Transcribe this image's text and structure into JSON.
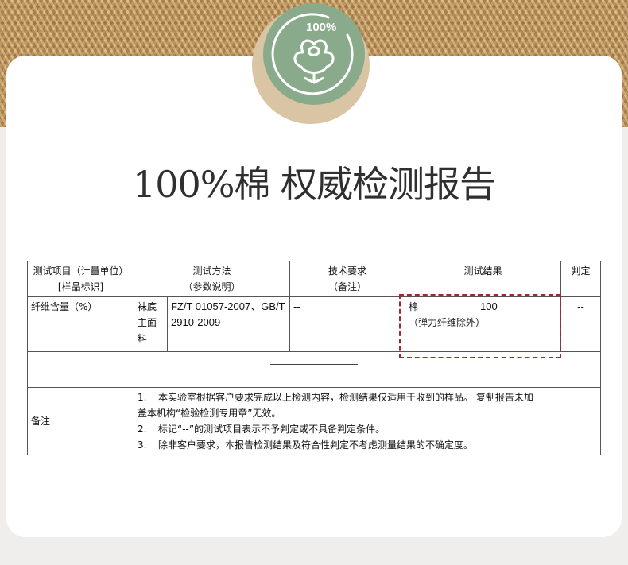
{
  "badge": {
    "percent": "100%",
    "icon": "cotton-flower-icon",
    "color": "#8aab8b"
  },
  "title": "100%棉  权威检测报告",
  "table": {
    "headers": {
      "col1_line1": "测试项目（计量单位）",
      "col1_line2": "[样品标识]",
      "col2_line1": "测试方法",
      "col2_line2": "（参数说明）",
      "col3_line1": "技术要求",
      "col3_line2": "（备注）",
      "col4": "测试结果",
      "col5": "判定"
    },
    "row": {
      "item": "纤维含量（%）",
      "part_lines": [
        "袜底",
        "主面",
        "料"
      ],
      "method_line1": "FZ/T 01057-2007、GB/T",
      "method_line2": "2910-2009",
      "requirement": "--",
      "result_name": "棉",
      "result_value": "100",
      "result_note": "（弹力纤维除外）",
      "judgement": "--"
    },
    "notes_label": "备注",
    "notes": [
      {
        "n": "1.",
        "text": "本实验室根据客户要求完成以上检测内容，检测结果仅适用于收到的样品。 复制报告未加"
      },
      {
        "n": "",
        "text": "盖本机构“检验检测专用章”无效。"
      },
      {
        "n": "2.",
        "text": "标记“--”的测试项目表示不予判定或不具备判定条件。"
      },
      {
        "n": "3.",
        "text": "除非客户要求，本报告检测结果及符合性判定不考虑测量结果的不确定度。"
      }
    ]
  }
}
